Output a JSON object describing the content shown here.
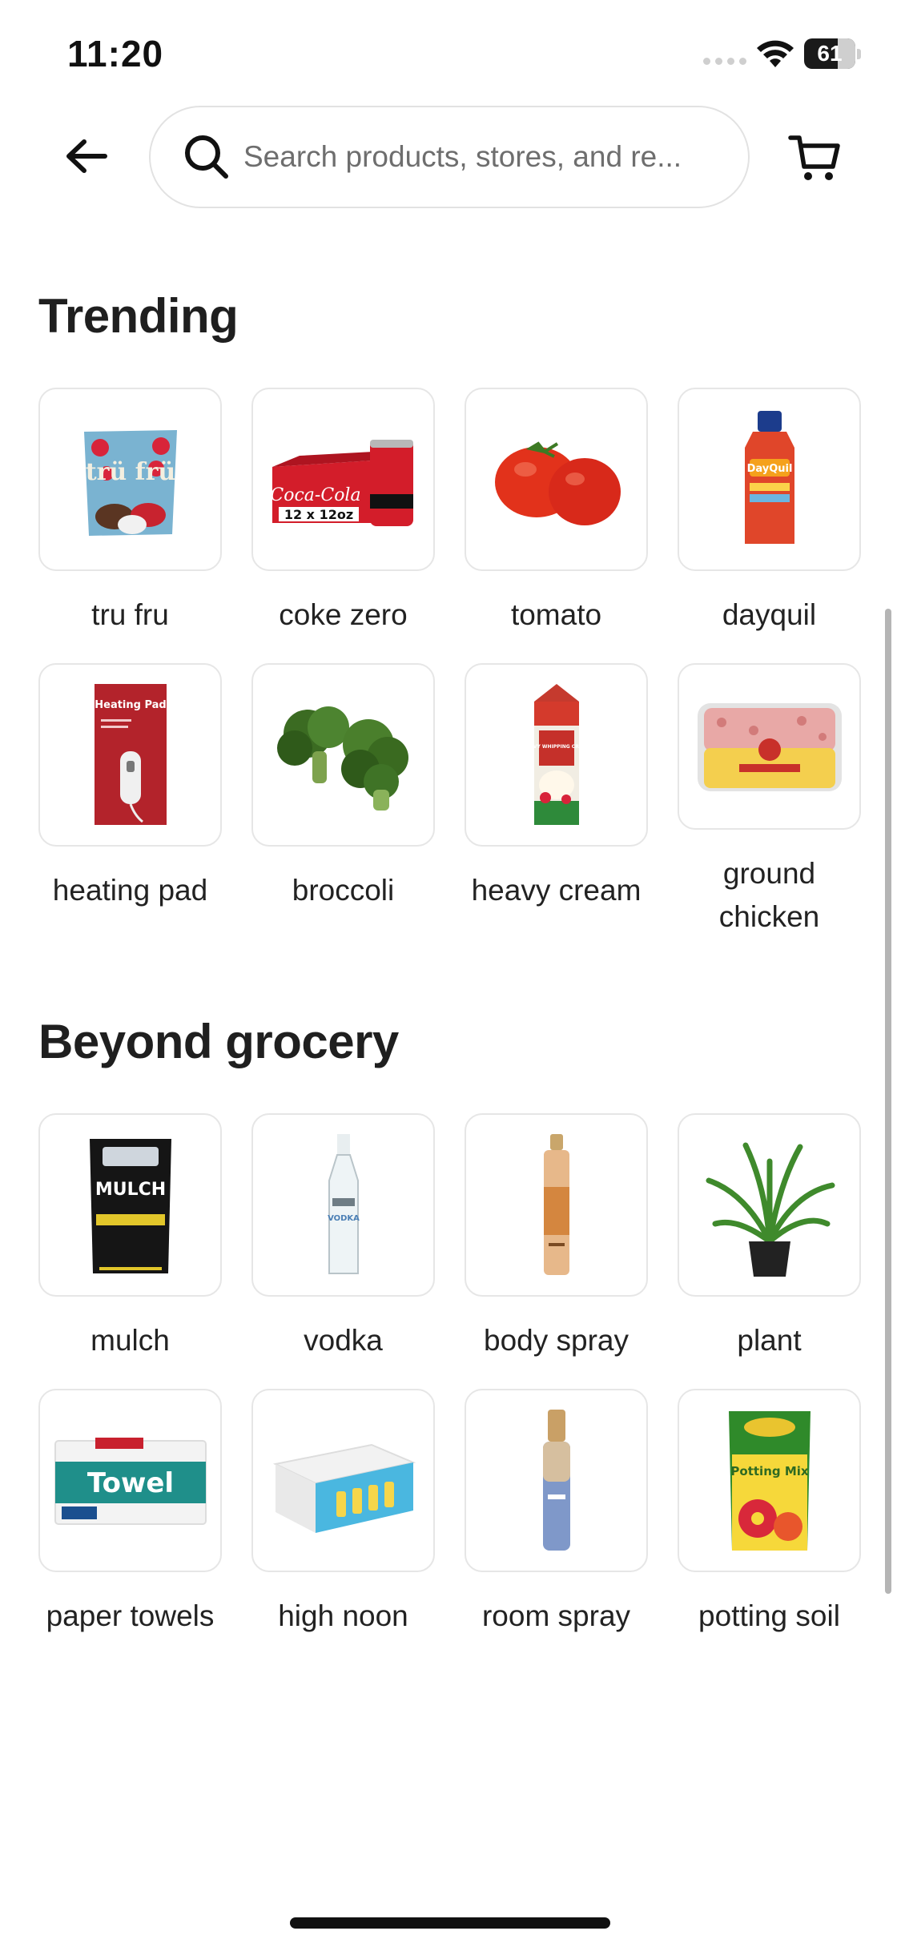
{
  "status_bar": {
    "time": "11:20",
    "battery": "61"
  },
  "search": {
    "placeholder": "Search products, stores, and re..."
  },
  "sections": [
    {
      "title": "Trending",
      "items": [
        {
          "label": "tru fru",
          "icon": "tru-fru-image"
        },
        {
          "label": "coke zero",
          "icon": "coke-zero-image"
        },
        {
          "label": "tomato",
          "icon": "tomato-image"
        },
        {
          "label": "dayquil",
          "icon": "dayquil-image"
        },
        {
          "label": "heating pad",
          "icon": "heating-pad-image"
        },
        {
          "label": "broccoli",
          "icon": "broccoli-image"
        },
        {
          "label": "heavy cream",
          "icon": "heavy-cream-image"
        },
        {
          "label": "ground chicken",
          "icon": "ground-chicken-image"
        }
      ]
    },
    {
      "title": "Beyond grocery",
      "items": [
        {
          "label": "mulch",
          "icon": "mulch-image"
        },
        {
          "label": "vodka",
          "icon": "vodka-image"
        },
        {
          "label": "body spray",
          "icon": "body-spray-image"
        },
        {
          "label": "plant",
          "icon": "plant-image"
        },
        {
          "label": "paper towels",
          "icon": "paper-towels-image"
        },
        {
          "label": "high noon",
          "icon": "high-noon-image"
        },
        {
          "label": "room spray",
          "icon": "room-spray-image"
        },
        {
          "label": "potting soil",
          "icon": "potting-soil-image"
        }
      ]
    }
  ],
  "product_art": {
    "tru_fru": "trü frü",
    "coke_zero": "12 x 12oz",
    "heating_pad": "Heating Pad",
    "heavy_cream": "HEAVY WHIPPING CREAM",
    "mulch": "MULCH",
    "vodka": "VODKA",
    "paper_towels": "Towel",
    "potting_soil": "Potting Mix"
  }
}
